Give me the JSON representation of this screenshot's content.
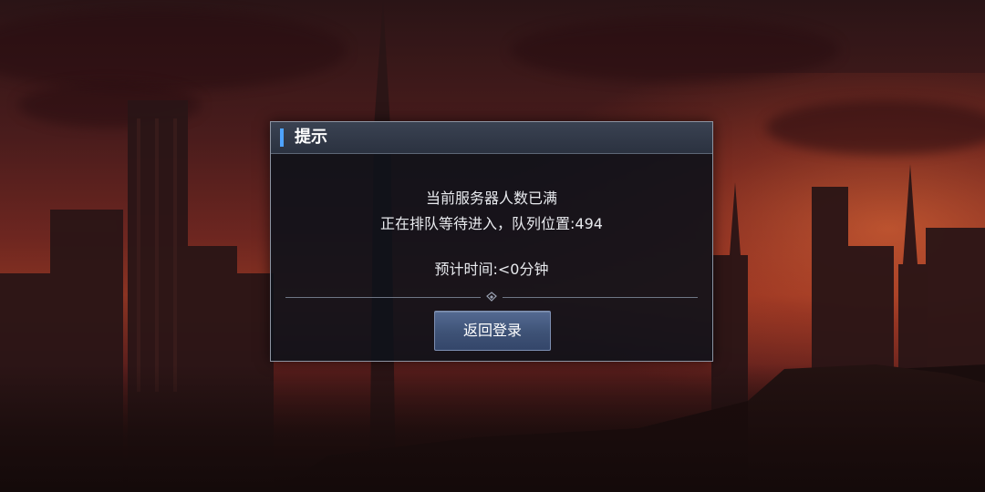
{
  "dialog": {
    "title": "提示",
    "line1": "当前服务器人数已满",
    "line2": "正在排队等待进入，队列位置:494",
    "line3": "预计时间:<0分钟",
    "button_label": "返回登录"
  },
  "colors": {
    "accent": "#4ea3ff",
    "button": "#46597e",
    "panel": "#0e121a"
  },
  "icons": [
    "diamond-icon"
  ]
}
